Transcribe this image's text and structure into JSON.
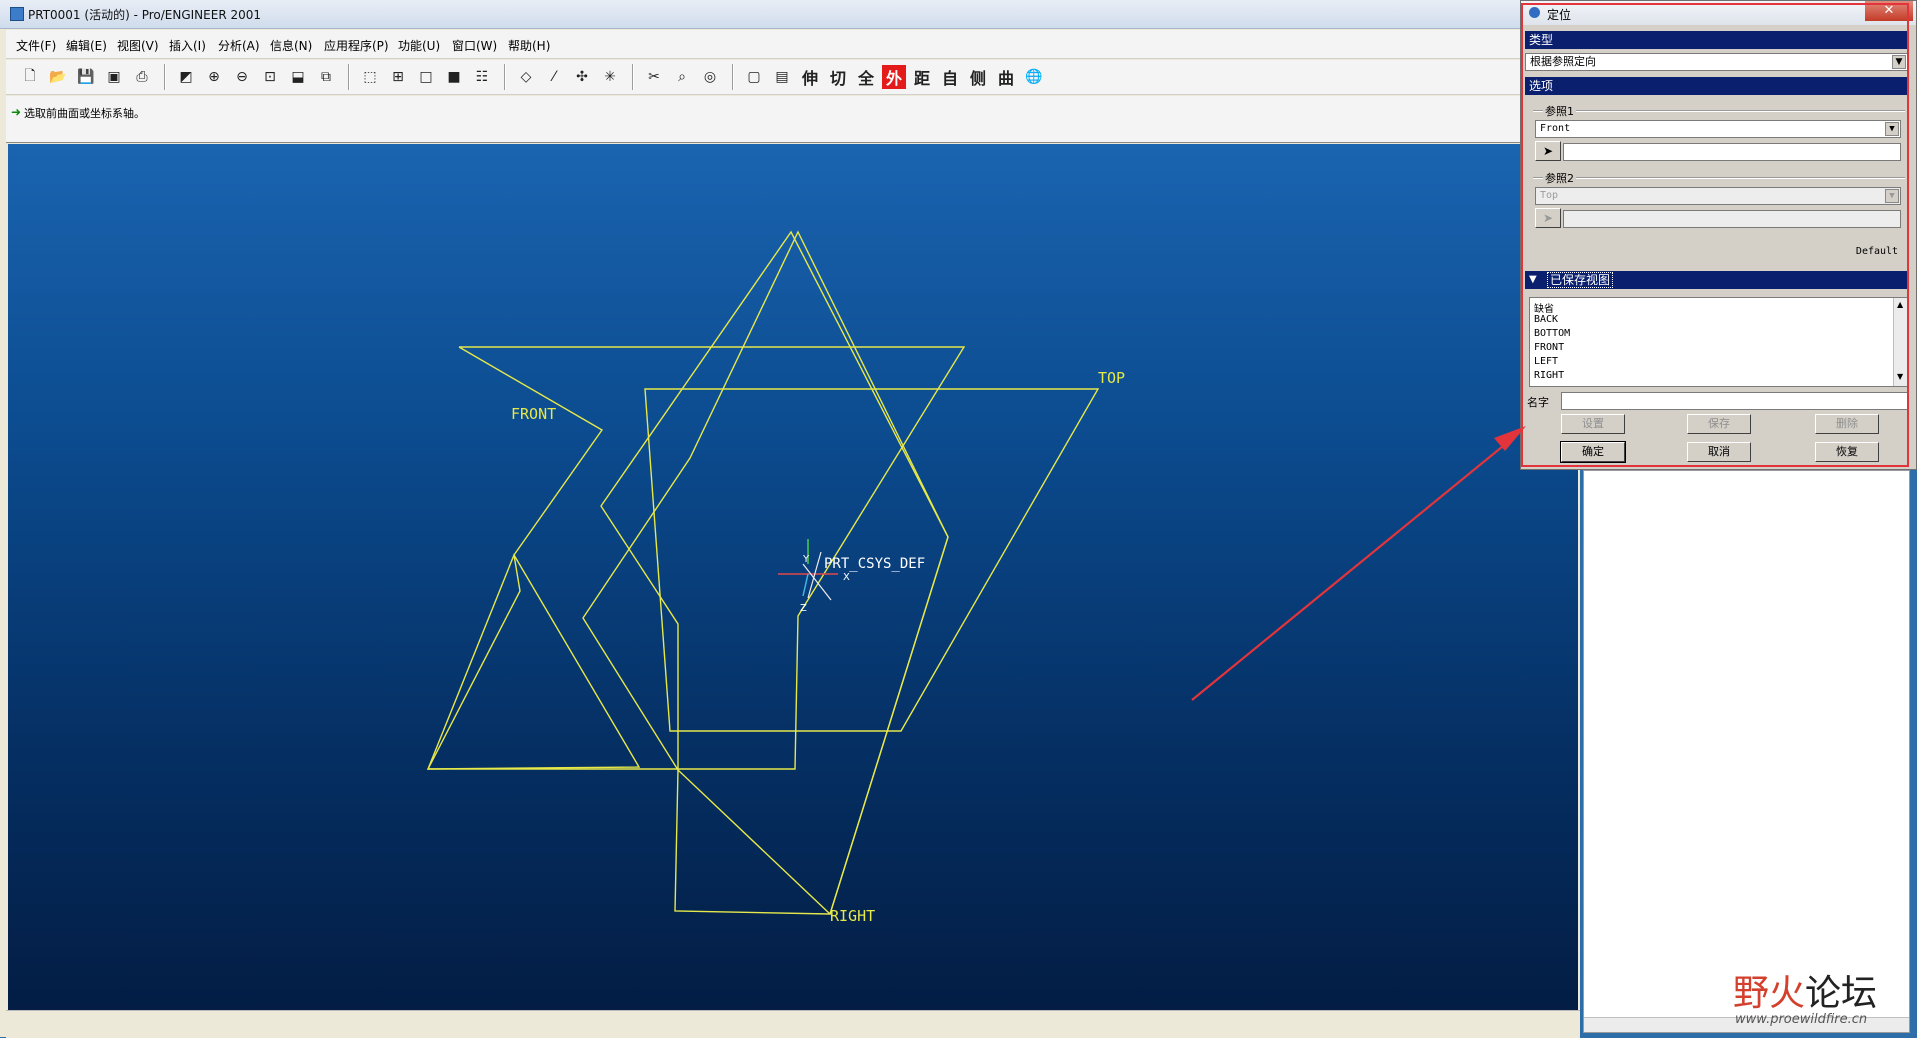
{
  "window": {
    "title": "PRT0001 (活动的) - Pro/ENGINEER 2001"
  },
  "menu": [
    "文件(F)",
    "编辑(E)",
    "视图(V)",
    "插入(I)",
    "分析(A)",
    "信息(N)",
    "应用程序(P)",
    "功能(U)",
    "窗口(W)",
    "帮助(H)"
  ],
  "toolbar": {
    "text_buttons": [
      "伸",
      "切",
      "全",
      "外",
      "距",
      "自",
      "侧",
      "曲"
    ],
    "highlight_color": "#e31b1b"
  },
  "message": "选取前曲面或坐标系轴。",
  "graphics": {
    "planes": [
      {
        "label": "FRONT"
      },
      {
        "label": "TOP"
      },
      {
        "label": "RIGHT"
      }
    ],
    "csys": {
      "label": "PRT_CSYS_DEF",
      "axes": [
        "Y",
        "X",
        "Z"
      ]
    },
    "datum_color": "#e6e84a"
  },
  "dialog": {
    "title": "定位",
    "close_label": "✕",
    "type_section": "类型",
    "type_value": "根据参照定向",
    "options_section": "选项",
    "ref1_label": "参照1",
    "ref1_value": "Front",
    "ref2_label": "参照2",
    "ref2_value": "Top",
    "default_button": "Default",
    "saved_views_section": "已保存视图",
    "saved_views": [
      "缺省",
      "BACK",
      "BOTTOM",
      "FRONT",
      "LEFT",
      "RIGHT"
    ],
    "name_label": "名字",
    "set_button": "设置",
    "save_button": "保存",
    "delete_button": "删除",
    "ok_button": "确定",
    "cancel_button": "取消",
    "restore_button": "恢复"
  },
  "watermark": {
    "part1": "野火",
    "part2": "论坛",
    "url": "www.proewildfire.cn"
  },
  "annotation_color": "#e3343b"
}
